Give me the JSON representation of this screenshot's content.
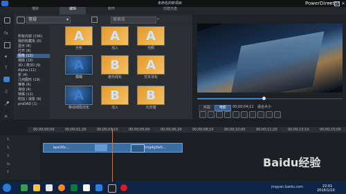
{
  "app": {
    "title": "未命名的新項目",
    "brand": "PowerDirector"
  },
  "tabs": [
    {
      "label": "捕获"
    },
    {
      "label": "编辑"
    },
    {
      "label": "制作"
    },
    {
      "label": "创建光盘"
    }
  ],
  "library": {
    "search_placeholder": "搜索库",
    "dropdown": "常规",
    "categories": [
      "所有内容 (156)",
      "我的收藏夹 (0)",
      "显示 (6)",
      "打开 (8)",
      "图像 (12)",
      "擦除 (16)",
      "3D / 类3D (9)",
      "Alpha (11)",
      "折 (4)",
      "几何图形 (19)",
      "推移 (6)",
      "滑动 (4)",
      "特殊 (11)",
      "附加 / 渐变 (9)",
      "proDAD (1)"
    ],
    "thumbnails": [
      {
        "label": "分形",
        "style": "orange",
        "glyph": "A"
      },
      {
        "label": "溶入",
        "style": "orange",
        "glyph": "A"
      },
      {
        "label": "光照",
        "style": "orange",
        "glyph": "A"
      },
      {
        "label": "模糊",
        "style": "blue",
        "glyph": "A"
      },
      {
        "label": "遮光线化",
        "style": "orange",
        "glyph": "B"
      },
      {
        "label": "交叉溶化",
        "style": "orange",
        "glyph": "A"
      },
      {
        "label": "移动线隐溶化",
        "style": "blue",
        "glyph": "A"
      },
      {
        "label": "溶入",
        "style": "orange",
        "glyph": "B"
      },
      {
        "label": "元交错",
        "style": "orange",
        "glyph": "B"
      }
    ]
  },
  "preview": {
    "mode_left": "片段",
    "mode_right": "电影",
    "timecode": "00;00;04;11",
    "zoom": "适合大小"
  },
  "timeline": {
    "ruler": [
      "00;00;00;00",
      "00;00;01;20",
      "00;00;03;10",
      "00;00;05;00",
      "00;00;06;20",
      "00;00;08;10",
      "00;00;10;00",
      "00;00;11;20",
      "00;00;13;10",
      "00;00;15;00",
      "00;00;16;20"
    ],
    "tracks": [
      "1.",
      "1.",
      "2.",
      "fx",
      "T",
      "♪"
    ],
    "clip_a": "bpe36c...",
    "clip_b": "img4g3w5...",
    "clip_c": "s-8d9..."
  },
  "taskbar": {
    "time": "22:01",
    "date": "2016/1/10"
  },
  "watermark": {
    "main": "Baidu经验",
    "sub": "jingyan.baidu.com"
  }
}
